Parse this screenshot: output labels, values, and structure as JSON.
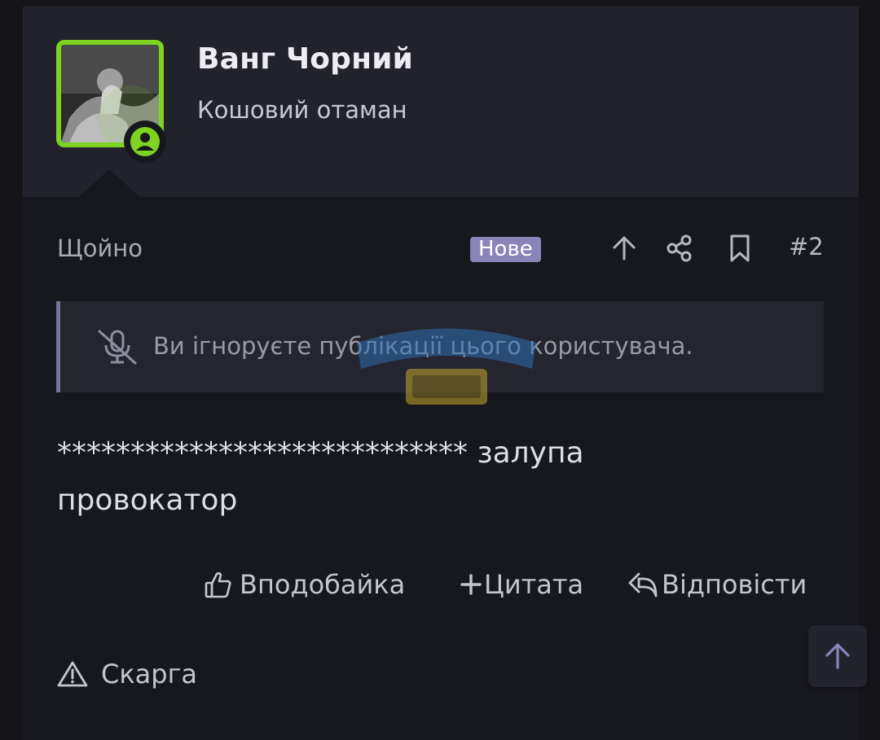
{
  "user": {
    "name": "Ванг Чорний",
    "title": "Кошовий отаман"
  },
  "meta": {
    "time": "Щойно",
    "badge": "Нове",
    "post_number": "#2",
    "icons": [
      "arrow-up-icon",
      "share-icon",
      "bookmark-icon"
    ]
  },
  "ignore_notice": {
    "text": "Ви ігноруєте публікації цього користувача.",
    "icon": "muted-microphone-icon"
  },
  "post": {
    "line1": "**************************** залупа",
    "line2": "провокатор"
  },
  "actions": {
    "like": "Вподобайка",
    "quote": "Цитата",
    "reply": "Відповісти",
    "report": "Скарга"
  },
  "colors": {
    "accent_green": "#7ed321",
    "badge_purple": "#8a84b8",
    "header_bg": "#22222c",
    "page_bg": "#17171e"
  }
}
